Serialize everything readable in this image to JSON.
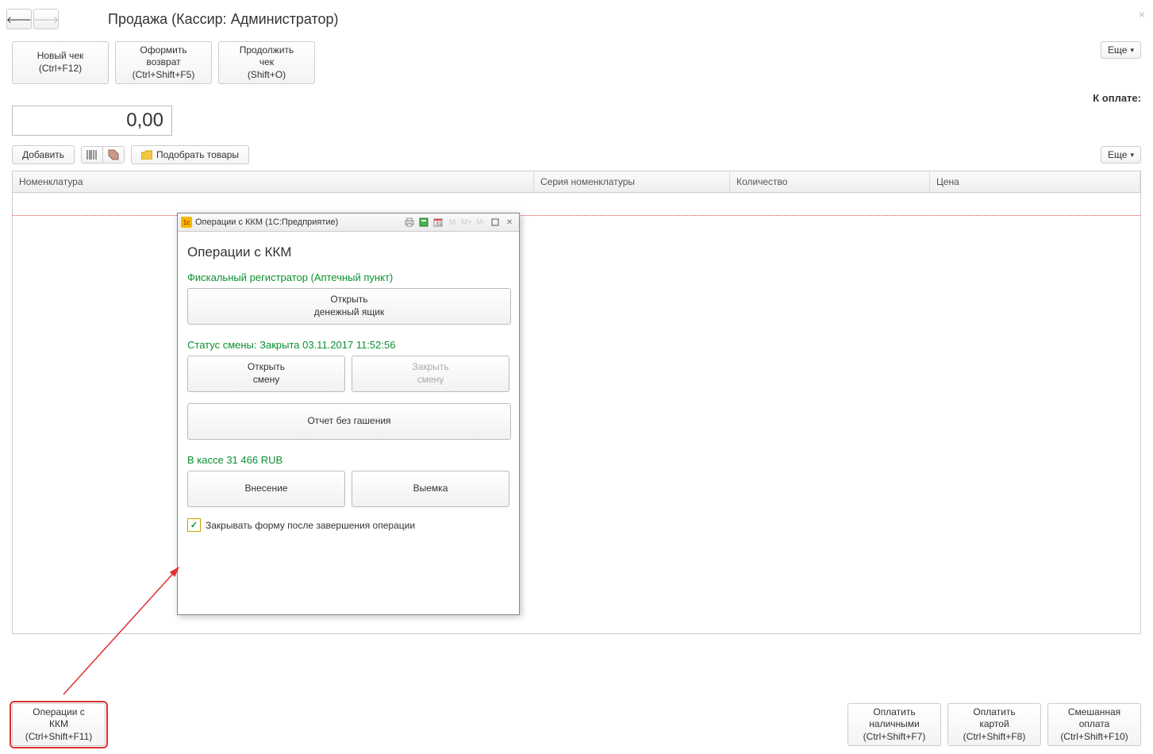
{
  "header": {
    "title": "Продажа (Кассир: Администратор)"
  },
  "toolbar": {
    "new_check_l1": "Новый чек",
    "new_check_l2": "(Ctrl+F12)",
    "refund_l1": "Оформить",
    "refund_l2": "возврат",
    "refund_l3": "(Ctrl+Shift+F5)",
    "continue_l1": "Продолжить",
    "continue_l2": "чек",
    "continue_l3": "(Shift+O)",
    "more": "Еще"
  },
  "payment": {
    "label": "К оплате:",
    "amount": "0,00"
  },
  "toolbar2": {
    "add": "Добавить",
    "pick": "Подобрать товары",
    "more": "Еще"
  },
  "table": {
    "col1": "Номенклатура",
    "col2": "Серия номенклатуры",
    "col3": "Количество",
    "col4": "Цена"
  },
  "bottom": {
    "kkm_l1": "Операции с",
    "kkm_l2": "ККМ",
    "kkm_l3": "(Ctrl+Shift+F11)",
    "pay_cash_l1": "Оплатить",
    "pay_cash_l2": "наличными",
    "pay_cash_l3": "(Ctrl+Shift+F7)",
    "pay_card_l1": "Оплатить",
    "pay_card_l2": "картой",
    "pay_card_l3": "(Ctrl+Shift+F8)",
    "pay_mix_l1": "Смешанная",
    "pay_mix_l2": "оплата",
    "pay_mix_l3": "(Ctrl+Shift+F10)"
  },
  "modal": {
    "titlebar": "Операции с ККМ  (1С:Предприятие)",
    "heading": "Операции с ККМ",
    "fiscal": "Фискальный регистратор (Аптечный пункт)",
    "open_drawer_l1": "Открыть",
    "open_drawer_l2": "денежный ящик",
    "shift_status": "Статус смены: Закрыта 03.11.2017 11:52:56",
    "open_shift_l1": "Открыть",
    "open_shift_l2": "смену",
    "close_shift_l1": "Закрыть",
    "close_shift_l2": "смену",
    "xreport": "Отчет без гашения",
    "cash_status": "В кассе 31 466 RUB",
    "deposit": "Внесение",
    "withdraw": "Выемка",
    "close_after": "Закрывать форму после завершения операции"
  }
}
